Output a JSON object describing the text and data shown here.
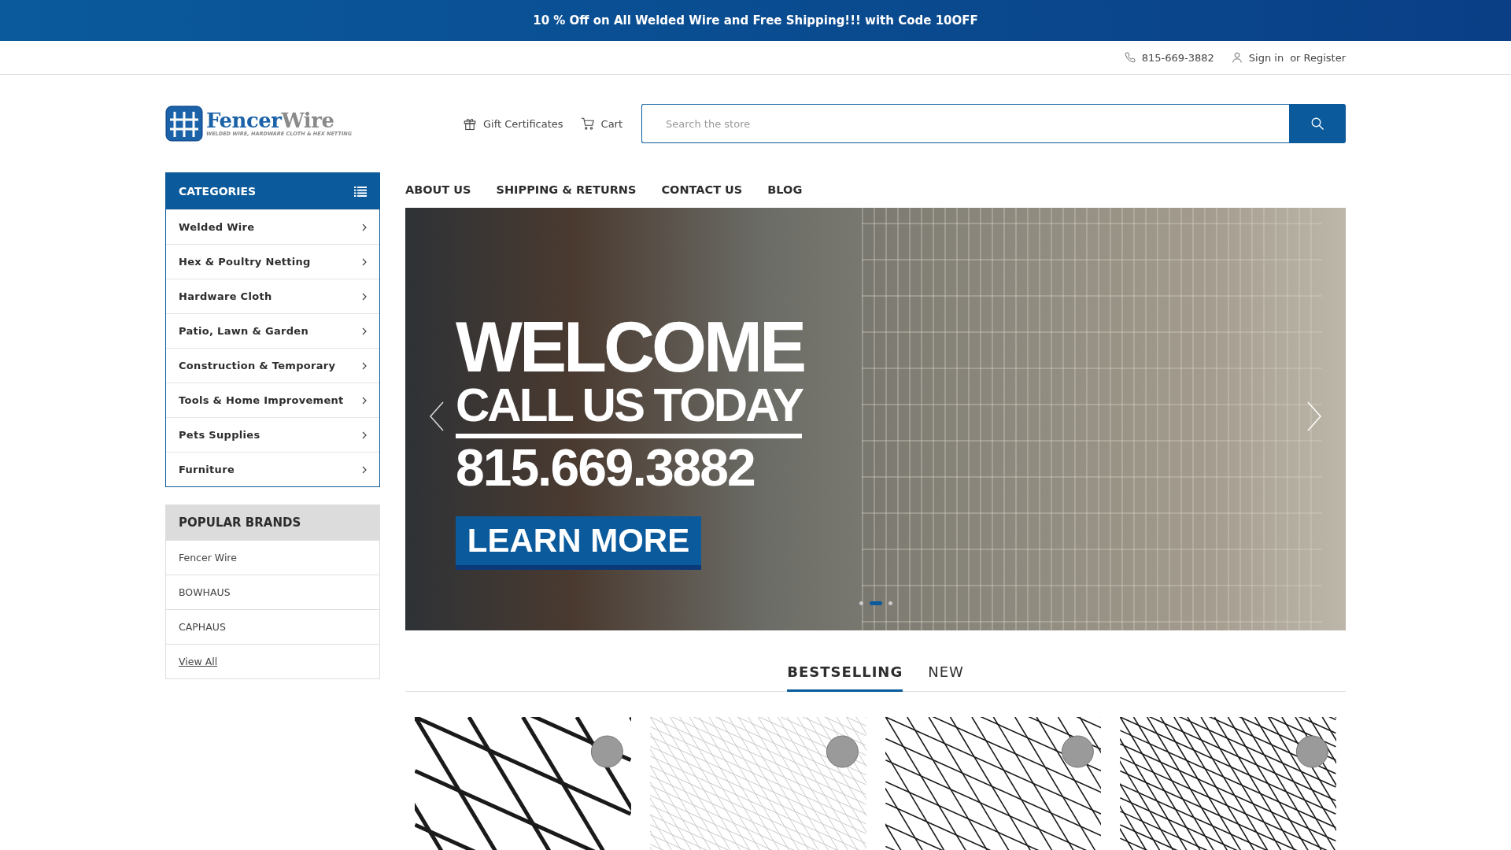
{
  "promo_bar": {
    "text": "10 % Off on All Welded Wire and Free Shipping!!! with Code 10OFF"
  },
  "top_bar": {
    "phone": "815-669-3882",
    "sign_in": "Sign in",
    "or": "or",
    "register": "Register"
  },
  "header": {
    "logo": {
      "name_first": "Fencer",
      "name_second": "Wire",
      "tagline": "WELDED WIRE, HARDWARE CLOTH & HEX NETTING"
    },
    "gift_certificates": "Gift Certificates",
    "cart": "Cart",
    "search": {
      "placeholder": "Search the store"
    }
  },
  "categories": {
    "title": "CATEGORIES",
    "items": [
      {
        "label": "Welded Wire"
      },
      {
        "label": "Hex & Poultry Netting"
      },
      {
        "label": "Hardware Cloth"
      },
      {
        "label": "Patio, Lawn & Garden"
      },
      {
        "label": "Construction & Temporary"
      },
      {
        "label": "Tools & Home Improvement"
      },
      {
        "label": "Pets Supplies"
      },
      {
        "label": "Furniture"
      }
    ]
  },
  "brands": {
    "title": "POPULAR BRANDS",
    "items": [
      "Fencer Wire",
      "BOWHAUS",
      "CAPHAUS"
    ],
    "view_all": "View All"
  },
  "nav": [
    "ABOUT US",
    "SHIPPING & RETURNS",
    "CONTACT US",
    "BLOG"
  ],
  "banner": {
    "headline": "WELCOME",
    "subhead": "CALL US TODAY",
    "phone": "815.669.3882",
    "button": "LEARN MORE",
    "dots": [
      {
        "selected": false
      },
      {
        "selected": true
      },
      {
        "selected": false
      }
    ]
  },
  "product_tabs": [
    {
      "label": "BESTSELLING",
      "selected": true
    },
    {
      "label": "NEW",
      "selected": false
    }
  ]
}
